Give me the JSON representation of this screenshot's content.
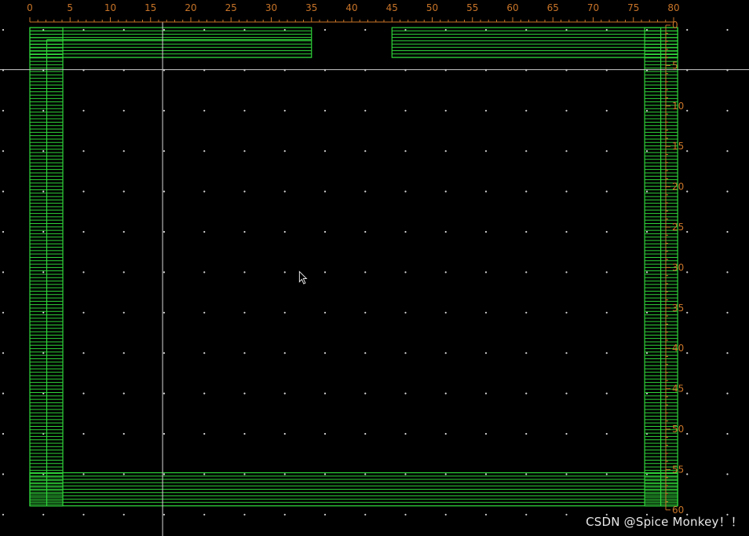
{
  "ruler": {
    "x_ticks": [
      "0",
      "5",
      "10",
      "15",
      "20",
      "25",
      "30",
      "35",
      "40",
      "45",
      "50",
      "55",
      "60",
      "65",
      "70",
      "75",
      "80"
    ],
    "y_ticks": [
      "0",
      "5",
      "10",
      "15",
      "20",
      "25",
      "30",
      "35",
      "40",
      "45",
      "50",
      "55",
      "60"
    ],
    "color": "#c87428"
  },
  "layout_units": {
    "x_range": [
      0,
      80
    ],
    "y_range": [
      0,
      60
    ]
  },
  "metal_color": "#2fd43a",
  "background_color": "#000000",
  "crosshair": {
    "x": 16.5,
    "y": 5.5,
    "color": "#c8c8c8"
  },
  "cursor": {
    "x": 33.5,
    "y": 30.5,
    "icon": "arrow-cursor-icon"
  },
  "watermark": "CSDN @Spice Monkey！！"
}
